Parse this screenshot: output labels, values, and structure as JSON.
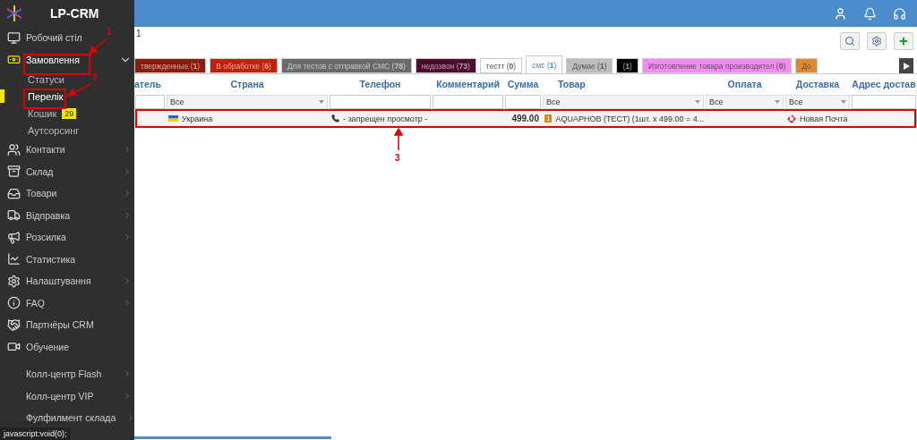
{
  "sidebar": {
    "brand": "LP-CRM",
    "items": [
      {
        "label": "Робочий стіл",
        "arrow": false,
        "selected": false
      },
      {
        "label": "Замовлення",
        "selected": true,
        "expanded": true,
        "children": [
          {
            "label": "Статуси",
            "selected": false
          },
          {
            "label": "Перелік",
            "selected": true
          },
          {
            "label": "Кошик",
            "badge": "29",
            "selected": false
          },
          {
            "label": "Аутсорсинг",
            "selected": false
          }
        ]
      },
      {
        "label": "Контакти",
        "arrow": true,
        "selected": false
      },
      {
        "label": "Склад",
        "arrow": true,
        "selected": false
      },
      {
        "label": "Товари",
        "arrow": true,
        "selected": false
      },
      {
        "label": "Відправка",
        "arrow": true,
        "selected": false
      },
      {
        "label": "Розсилка",
        "arrow": true,
        "selected": false
      },
      {
        "label": "Статистика",
        "arrow": false,
        "selected": false
      },
      {
        "label": "Налаштування",
        "arrow": true,
        "selected": false
      },
      {
        "label": "FAQ",
        "arrow": true,
        "selected": false
      },
      {
        "label": "Партнёры CRM",
        "arrow": false,
        "selected": false
      },
      {
        "label": "Обучение",
        "arrow": false,
        "selected": false
      },
      {
        "label": "Колл-центр Flash",
        "arrow": true,
        "selected": false
      },
      {
        "label": "Колл-центр VIP",
        "arrow": true,
        "selected": false
      },
      {
        "label": "Фулфилмент склада",
        "arrow": true,
        "selected": false
      }
    ]
  },
  "page_number": "1",
  "status_tabs": [
    {
      "label": "твержденные (**1**)",
      "color": "#8a1c0c",
      "selected": false
    },
    {
      "label": "В обработке (**6**)",
      "color": "#c0210b",
      "selected": false
    },
    {
      "label": "Для тестов с отправкой СМС (**78**)",
      "color": "#6a6a6a",
      "selected": false
    },
    {
      "label": "недозвон (**73**)",
      "color": "#4d0c2c",
      "selected": false
    },
    {
      "label": "тестт (**0**)",
      "color": "#ffffff",
      "selected": false
    },
    {
      "label": "смс (**1**)",
      "color": "#ffffff",
      "selected": true
    },
    {
      "label": "Думае (**1**)",
      "color": "#bdbdbd",
      "selected": false
    },
    {
      "label": "(**1**)",
      "color": "#000000",
      "selected": false
    },
    {
      "label": "Изготовление товара производител (**0**)",
      "color": "#f28cf2",
      "selected": false
    },
    {
      "label": "До",
      "color": "#e08a30",
      "selected": false
    }
  ],
  "table": {
    "columns": [
      {
        "label": "атель",
        "kind": "input"
      },
      {
        "label": "Страна",
        "kind": "select",
        "value": "Все"
      },
      {
        "label": "Телефон",
        "kind": "input"
      },
      {
        "label": "Комментарий",
        "kind": "input"
      },
      {
        "label": "Сумма",
        "kind": "input"
      },
      {
        "label": "Товар",
        "kind": "select",
        "value": "Все"
      },
      {
        "label": "Оплата",
        "kind": "select",
        "value": "Все"
      },
      {
        "label": "Доставка",
        "kind": "select",
        "value": "Все"
      },
      {
        "label": "Адрес достав",
        "kind": "input"
      }
    ],
    "rows": [
      {
        "country": "Украина",
        "phone": "- запрещен просмотр -",
        "sum": "499.00",
        "product_qty": "1",
        "product": "AQUAPHOB (ТЕСТ) (1шт. x 499.00 = 4...",
        "delivery": "Новая Почта"
      }
    ]
  },
  "annotations": [
    {
      "number": "1"
    },
    {
      "number": "2"
    },
    {
      "number": "3"
    }
  ],
  "status_bar": "javascript:void(0);"
}
